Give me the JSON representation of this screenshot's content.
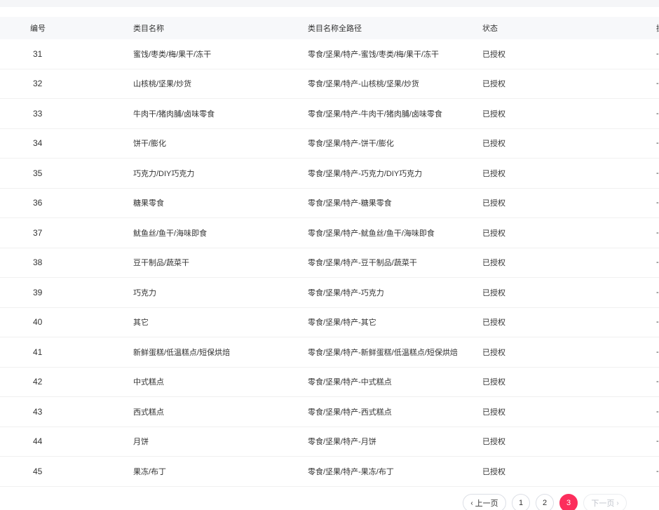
{
  "table": {
    "headers": {
      "id": "编号",
      "name": "类目名称",
      "path": "类目名称全路径",
      "status": "状态",
      "extra": "操作"
    },
    "rows": [
      {
        "id": "31",
        "name": "蜜饯/枣类/梅/果干/冻干",
        "path": "零食/坚果/特产-蜜饯/枣类/梅/果干/冻干",
        "status": "已授权",
        "extra": "-"
      },
      {
        "id": "32",
        "name": "山核桃/坚果/炒货",
        "path": "零食/坚果/特产-山核桃/坚果/炒货",
        "status": "已授权",
        "extra": "-"
      },
      {
        "id": "33",
        "name": "牛肉干/猪肉脯/卤味零食",
        "path": "零食/坚果/特产-牛肉干/猪肉脯/卤味零食",
        "status": "已授权",
        "extra": "-"
      },
      {
        "id": "34",
        "name": "饼干/膨化",
        "path": "零食/坚果/特产-饼干/膨化",
        "status": "已授权",
        "extra": "-"
      },
      {
        "id": "35",
        "name": "巧克力/DIY巧克力",
        "path": "零食/坚果/特产-巧克力/DIY巧克力",
        "status": "已授权",
        "extra": "-"
      },
      {
        "id": "36",
        "name": "糖果零食",
        "path": "零食/坚果/特产-糖果零食",
        "status": "已授权",
        "extra": "-"
      },
      {
        "id": "37",
        "name": "鱿鱼丝/鱼干/海味即食",
        "path": "零食/坚果/特产-鱿鱼丝/鱼干/海味即食",
        "status": "已授权",
        "extra": "-"
      },
      {
        "id": "38",
        "name": "豆干制品/蔬菜干",
        "path": "零食/坚果/特产-豆干制品/蔬菜干",
        "status": "已授权",
        "extra": "-"
      },
      {
        "id": "39",
        "name": "巧克力",
        "path": "零食/坚果/特产-巧克力",
        "status": "已授权",
        "extra": "-"
      },
      {
        "id": "40",
        "name": "其它",
        "path": "零食/坚果/特产-其它",
        "status": "已授权",
        "extra": "-"
      },
      {
        "id": "41",
        "name": "新鲜蛋糕/低温糕点/短保烘焙",
        "path": "零食/坚果/特产-新鲜蛋糕/低温糕点/短保烘焙",
        "status": "已授权",
        "extra": "-"
      },
      {
        "id": "42",
        "name": "中式糕点",
        "path": "零食/坚果/特产-中式糕点",
        "status": "已授权",
        "extra": "-"
      },
      {
        "id": "43",
        "name": "西式糕点",
        "path": "零食/坚果/特产-西式糕点",
        "status": "已授权",
        "extra": "-"
      },
      {
        "id": "44",
        "name": "月饼",
        "path": "零食/坚果/特产-月饼",
        "status": "已授权",
        "extra": "-"
      },
      {
        "id": "45",
        "name": "果冻/布丁",
        "path": "零食/坚果/特产-果冻/布丁",
        "status": "已授权",
        "extra": "-"
      }
    ]
  },
  "pagination": {
    "prev_label": "上一页",
    "next_label": "下一页",
    "prev_icon": "‹",
    "next_icon": "›",
    "pages": [
      "1",
      "2",
      "3"
    ],
    "current": "3",
    "accent_color": "#fc2e5c"
  }
}
